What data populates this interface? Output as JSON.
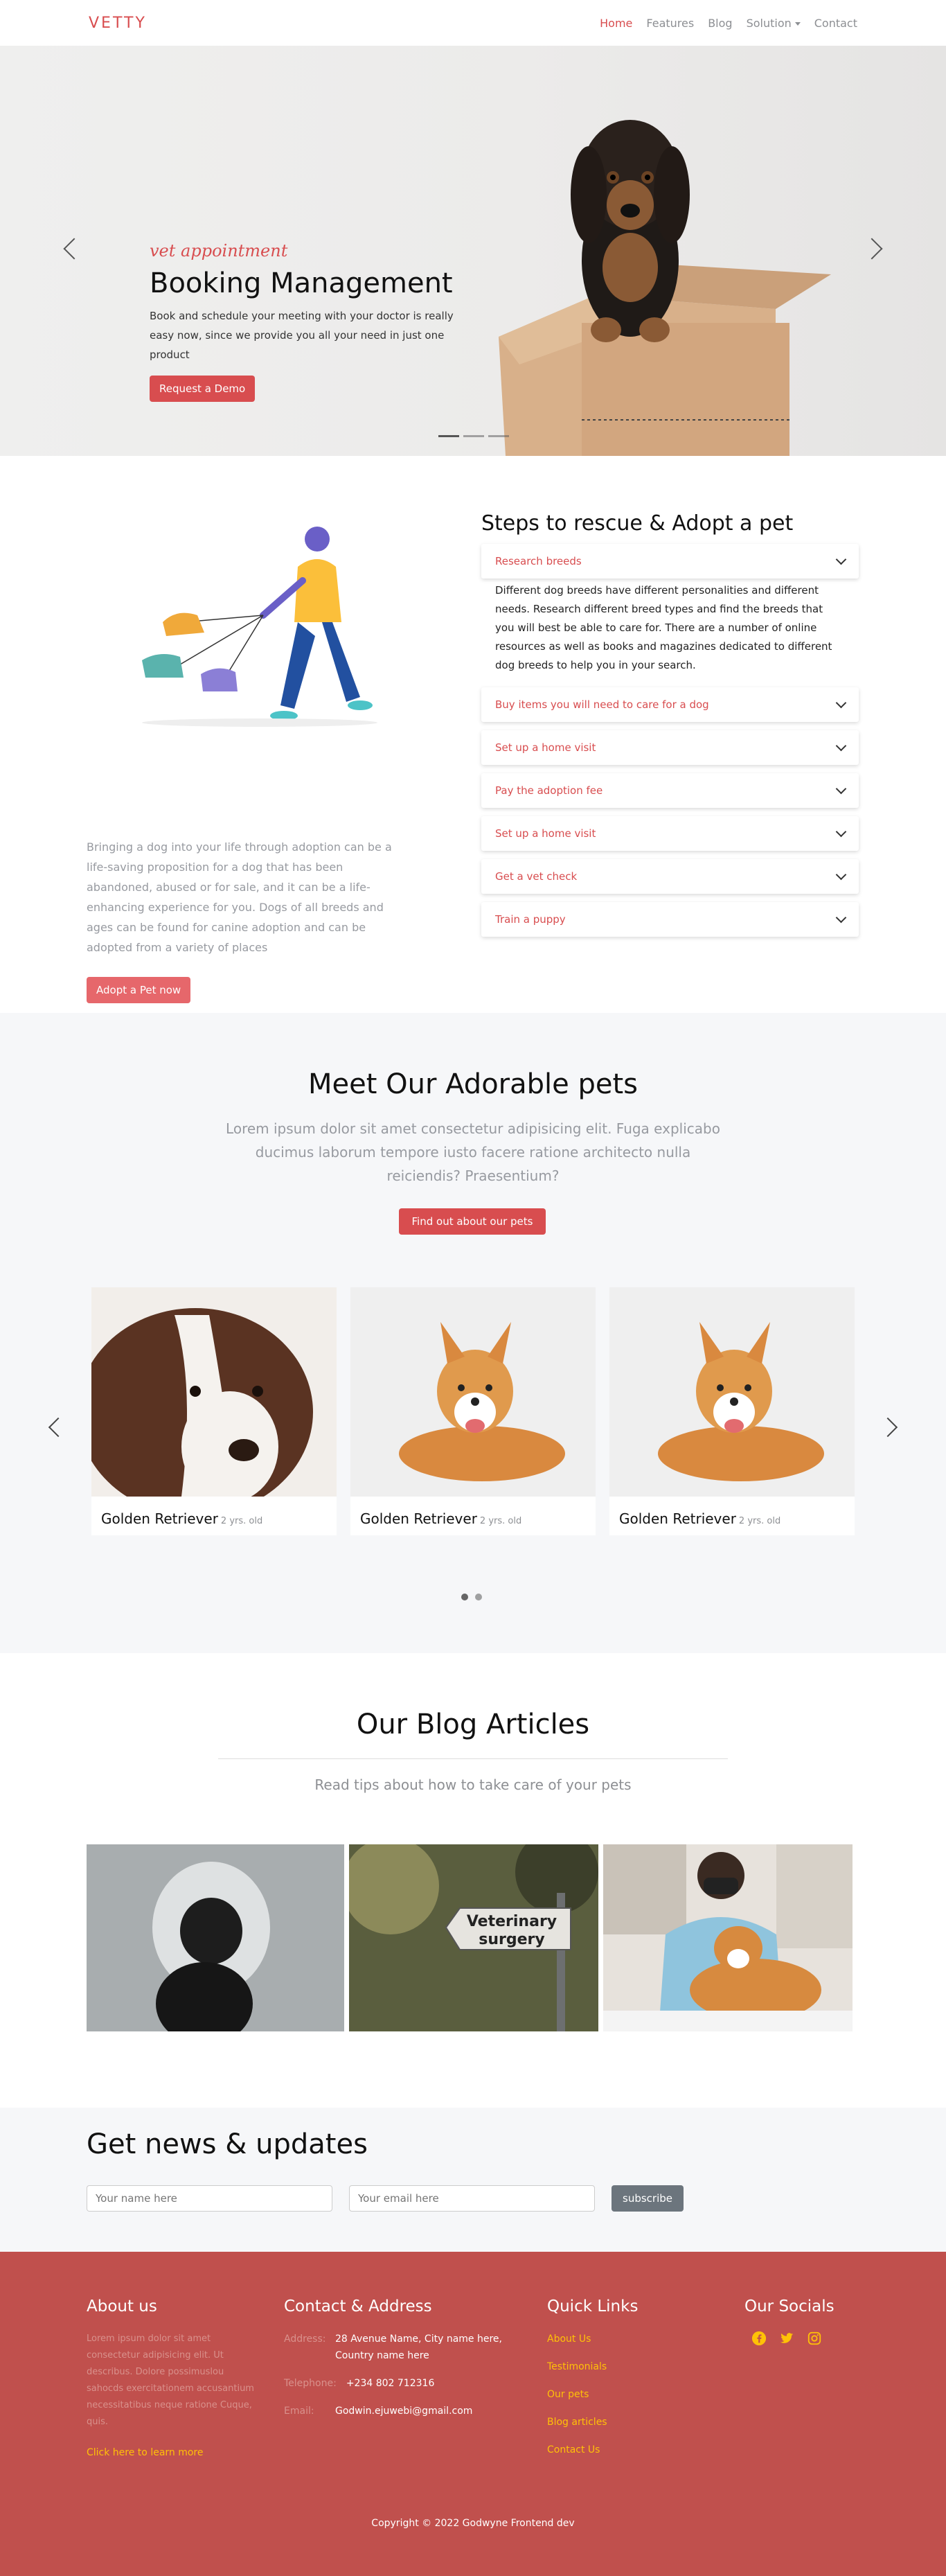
{
  "nav": {
    "brand": "VETTY",
    "links": [
      "Home",
      "Features",
      "Blog",
      "Solution",
      "Contact"
    ]
  },
  "hero": {
    "kicker": "vet appointment",
    "title": "Booking Management",
    "description": "Book and schedule your meeting with your doctor is really easy now, since we provide you all your need in just one product",
    "button": "Request a Demo"
  },
  "adopt": {
    "paragraph": "Bringing a dog into your life through adoption can be a life-saving proposition for a dog that has been abandoned, abused or for sale, and it can be a life-enhancing experience for you. Dogs of all breeds and ages can be found for canine adoption and can be adopted from a variety of places",
    "button": "Adopt a Pet now",
    "steps_title": "Steps to rescue & Adopt a pet",
    "steps": [
      "Research breeds",
      "Buy items you will need to care for a dog",
      "Set up a home visit",
      "Pay the adoption fee",
      "Set up a home visit",
      "Get a vet check",
      "Train a puppy"
    ],
    "open_body": "Different dog breeds have different personalities and different needs. Research different breed types and find the breeds that you will best be able to care for. There are a number of online resources as well as books and magazines dedicated to different dog breeds to help you in your search."
  },
  "pets": {
    "title": "Meet Our Adorable pets",
    "subtitle": "Lorem ipsum dolor sit amet consectetur adipisicing elit. Fuga explicabo ducimus laborum tempore iusto facere ratione architecto nulla reiciendis? Praesentium?",
    "button": "Find out about our pets",
    "cards": [
      {
        "name": "Golden Retriever",
        "age": "2 yrs. old"
      },
      {
        "name": "Golden Retriever",
        "age": "2 yrs. old"
      },
      {
        "name": "Golden Retriever",
        "age": "2 yrs. old"
      }
    ]
  },
  "blog": {
    "title": "Our Blog Articles",
    "subtitle": "Read tips about how to take care of your pets",
    "sign_line1": "Veterinary",
    "sign_line2": "surgery"
  },
  "news": {
    "title": "Get news & updates",
    "name_placeholder": "Your name here",
    "email_placeholder": "Your email here",
    "button": "subscribe"
  },
  "footer": {
    "about_title": "About us",
    "about_text": "Lorem ipsum dolor sit amet consectetur adipisicing elit. Ut describus. Dolore possimuslou sahocds exercitationem accusantium necessitatibus neque ratione Cuque, quis.",
    "about_link": "Click here to learn more",
    "contact_title": "Contact & Address",
    "address_label": "Address:",
    "address": "28 Avenue Name, City name here, Country name here",
    "phone_label": "Telephone:",
    "phone": "+234 802 712316",
    "email_label": "Email:",
    "email": "Godwin.ejuwebi@gmail.com",
    "quick_title": "Quick Links",
    "quick_links": [
      "About Us",
      "Testimonials",
      "Our pets",
      "Blog articles",
      "Contact Us"
    ],
    "social_title": "Our Socials",
    "copyright": "Copyright © 2022 Godwyne Frontend dev"
  },
  "colors": {
    "accent": "#d84d4f",
    "footer_bg": "#c0504d",
    "link_yellow": "#ffc107"
  }
}
